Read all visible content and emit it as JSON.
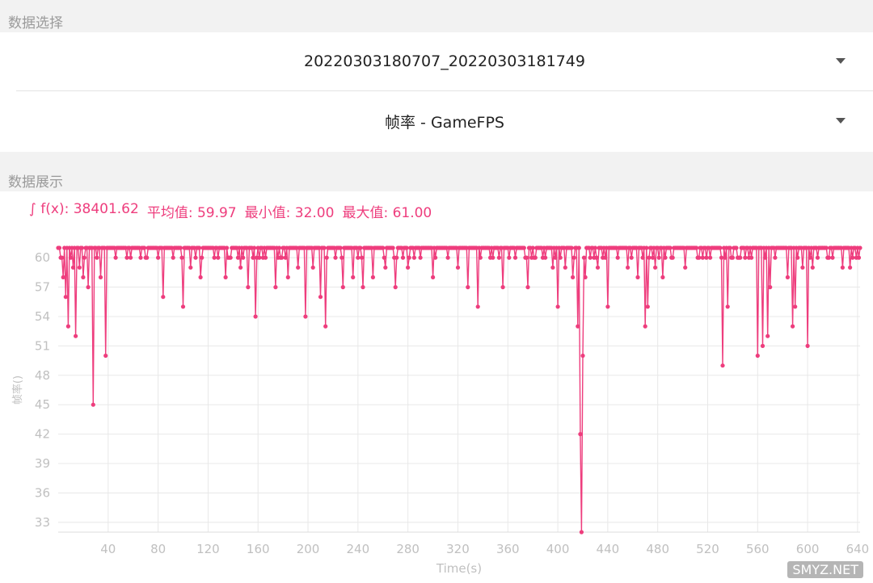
{
  "sections": {
    "select_title": "数据选择",
    "display_title": "数据展示"
  },
  "selectors": {
    "file": "20220303180707_20220303181749",
    "metric": "帧率 - GameFPS"
  },
  "stats": {
    "integral": "∫ f(x): 38401.62",
    "average": "平均值: 59.97",
    "min": "最小值: 32.00",
    "max": "最大值: 61.00"
  },
  "watermark": "SMYZ.NET",
  "colors": {
    "line": "#ee3d7d",
    "grid": "#e8e8e8",
    "axis_text": "#c0c0c0"
  },
  "chart_data": {
    "type": "line",
    "xlabel": "Time(s)",
    "ylabel": "帧率()",
    "xlim": [
      0,
      642
    ],
    "ylim": [
      32,
      61
    ],
    "xticks": [
      40,
      80,
      120,
      160,
      200,
      240,
      280,
      320,
      360,
      400,
      440,
      480,
      520,
      560,
      600,
      640
    ],
    "yticks": [
      33,
      36,
      39,
      42,
      45,
      48,
      51,
      54,
      57,
      60
    ],
    "grid": true,
    "baseline": 61,
    "dips": [
      [
        2,
        60
      ],
      [
        4,
        58
      ],
      [
        6,
        56
      ],
      [
        8,
        53
      ],
      [
        12,
        59
      ],
      [
        14,
        52
      ],
      [
        17,
        59
      ],
      [
        20,
        58
      ],
      [
        24,
        57
      ],
      [
        28,
        45
      ],
      [
        34,
        58
      ],
      [
        38,
        50
      ],
      [
        46,
        60
      ],
      [
        58,
        60
      ],
      [
        66,
        60
      ],
      [
        80,
        60
      ],
      [
        84,
        56
      ],
      [
        92,
        60
      ],
      [
        100,
        55
      ],
      [
        106,
        59
      ],
      [
        114,
        58
      ],
      [
        128,
        60
      ],
      [
        134,
        58
      ],
      [
        146,
        59
      ],
      [
        152,
        57
      ],
      [
        158,
        54
      ],
      [
        166,
        60
      ],
      [
        174,
        57
      ],
      [
        184,
        58
      ],
      [
        192,
        59
      ],
      [
        198,
        54
      ],
      [
        204,
        59
      ],
      [
        210,
        56
      ],
      [
        214,
        53
      ],
      [
        222,
        60
      ],
      [
        228,
        57
      ],
      [
        236,
        58
      ],
      [
        244,
        57
      ],
      [
        252,
        58
      ],
      [
        262,
        59
      ],
      [
        270,
        57
      ],
      [
        280,
        59
      ],
      [
        290,
        60
      ],
      [
        300,
        58
      ],
      [
        312,
        60
      ],
      [
        320,
        59
      ],
      [
        328,
        57
      ],
      [
        336,
        55
      ],
      [
        346,
        60
      ],
      [
        356,
        57
      ],
      [
        366,
        60
      ],
      [
        376,
        57
      ],
      [
        388,
        60
      ],
      [
        396,
        59
      ],
      [
        400,
        55
      ],
      [
        406,
        59
      ],
      [
        412,
        58
      ],
      [
        416,
        53
      ],
      [
        418,
        42
      ],
      [
        419,
        32
      ],
      [
        420,
        50
      ],
      [
        422,
        58
      ],
      [
        426,
        60
      ],
      [
        432,
        59
      ],
      [
        440,
        55
      ],
      [
        448,
        60
      ],
      [
        456,
        59
      ],
      [
        464,
        58
      ],
      [
        470,
        53
      ],
      [
        472,
        55
      ],
      [
        478,
        59
      ],
      [
        484,
        58
      ],
      [
        492,
        60
      ],
      [
        502,
        59
      ],
      [
        512,
        60
      ],
      [
        522,
        60
      ],
      [
        532,
        49
      ],
      [
        536,
        55
      ],
      [
        546,
        60
      ],
      [
        560,
        50
      ],
      [
        564,
        51
      ],
      [
        568,
        52
      ],
      [
        570,
        57
      ],
      [
        574,
        60
      ],
      [
        584,
        58
      ],
      [
        588,
        53
      ],
      [
        590,
        55
      ],
      [
        596,
        59
      ],
      [
        600,
        51
      ],
      [
        602,
        60
      ],
      [
        604,
        59
      ],
      [
        608,
        60
      ],
      [
        616,
        60
      ],
      [
        628,
        59
      ],
      [
        634,
        59
      ]
    ]
  }
}
